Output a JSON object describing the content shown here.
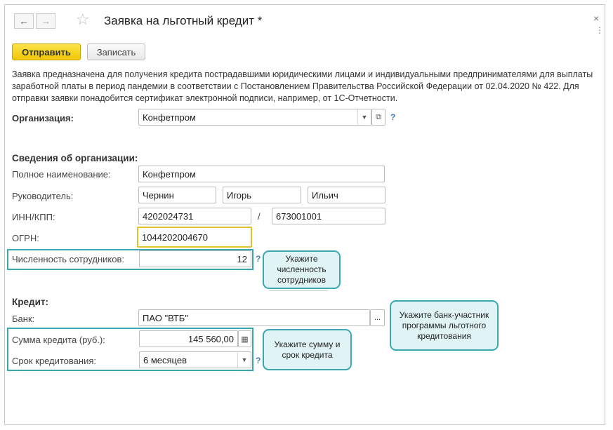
{
  "window": {
    "title": "Заявка на льготный кредит *",
    "nav_back_icon": "←",
    "nav_forward_icon": "→",
    "favorite_icon": "☆",
    "close_icon": "×",
    "menu_icon": "⋮"
  },
  "toolbar": {
    "send_label": "Отправить",
    "save_label": "Записать"
  },
  "description": "Заявка предназначена для получения кредита пострадавшими юридическими лицами и индивидуальными предпринимателями для выплаты заработной платы в период пандемии в соответствии с Постановлением Правительства Российской Федерации от 02.04.2020 № 422. Для отправки заявки понадобится сертификат электронной подписи, например, от 1С-Отчетности.",
  "organization": {
    "label": "Организация:",
    "value": "Конфетпром",
    "help": "?"
  },
  "org_info": {
    "section_title": "Сведения об организации:",
    "full_name_label": "Полное наименование:",
    "full_name_value": "Конфетпром",
    "head_label": "Руководитель:",
    "head_last": "Чернин",
    "head_first": "Игорь",
    "head_middle": "Ильич",
    "inn_label": "ИНН/КПП:",
    "inn_value": "4202024731",
    "inn_sep": "/",
    "kpp_value": "673001001",
    "ogrn_label": "ОГРН:",
    "ogrn_value": "1044202004670",
    "staff_label": "Численность сотрудников:",
    "staff_value": "12",
    "help": "?"
  },
  "credit": {
    "section_title": "Кредит:",
    "bank_label": "Банк:",
    "bank_value": "ПАО \"ВТБ\"",
    "bank_select": "...",
    "amount_label": "Сумма кредита (руб.):",
    "amount_value": "145 560,00",
    "term_label": "Срок кредитования:",
    "term_value": "6 месяцев",
    "help": "?"
  },
  "callouts": {
    "staff": "Укажите численность сотрудников",
    "bank": "Укажите банк-участник программы льготного кредитования",
    "amount": "Укажите сумму и срок кредита"
  },
  "colors": {
    "primary_button": "#f2c700",
    "highlight": "#3ba7b0",
    "callout_fill": "#e0f4f6",
    "focus_border": "#e2c12a",
    "help_link": "#3b7bbf"
  }
}
